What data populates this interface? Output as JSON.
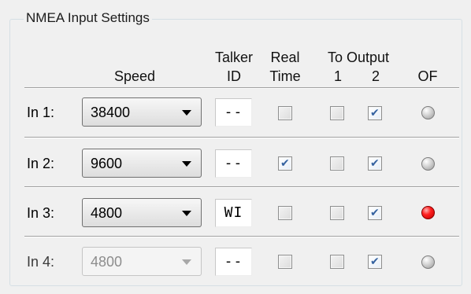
{
  "group_title": "NMEA Input Settings",
  "headers": {
    "speed": "Speed",
    "talker_line1": "Talker",
    "talker_line2": "ID",
    "realtime_line1": "Real",
    "realtime_line2": "Time",
    "to_output": "To Output",
    "out1": "1",
    "out2": "2",
    "of": "OF"
  },
  "rows": [
    {
      "label": "In 1:",
      "speed": "38400",
      "talker_id": "--",
      "real_time": false,
      "out1": false,
      "out2": true,
      "of_state": "off",
      "enabled": true
    },
    {
      "label": "In 2:",
      "speed": "9600",
      "talker_id": "--",
      "real_time": true,
      "out1": false,
      "out2": true,
      "of_state": "off",
      "enabled": true
    },
    {
      "label": "In 3:",
      "speed": "4800",
      "talker_id": "WI",
      "real_time": false,
      "out1": false,
      "out2": true,
      "of_state": "on",
      "enabled": true
    },
    {
      "label": "In 4:",
      "speed": "4800",
      "talker_id": "--",
      "real_time": false,
      "out1": false,
      "out2": true,
      "of_state": "off",
      "enabled": false
    }
  ],
  "colors": {
    "led_on": "#ff2020",
    "led_off": "#c8c8c8",
    "check_accent": "#3462a0"
  }
}
